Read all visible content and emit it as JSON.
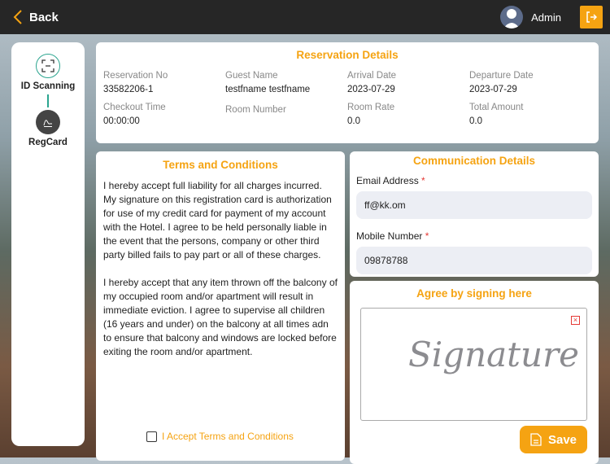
{
  "header": {
    "back_label": "Back",
    "user_name": "Admin"
  },
  "steps": [
    {
      "label": "ID Scanning"
    },
    {
      "label": "RegCard"
    }
  ],
  "reservation": {
    "title": "Reservation Details",
    "fields": [
      {
        "label": "Reservation No",
        "value": "33582206-1"
      },
      {
        "label": "Guest Name",
        "value": "testfname testfname"
      },
      {
        "label": "Arrival Date",
        "value": "2023-07-29"
      },
      {
        "label": "Departure Date",
        "value": "2023-07-29"
      },
      {
        "label": "Checkout Time",
        "value": "00:00:00"
      },
      {
        "label": "Room Number",
        "value": ""
      },
      {
        "label": "Room Rate",
        "value": "0.0"
      },
      {
        "label": "Total Amount",
        "value": "0.0"
      }
    ]
  },
  "terms": {
    "title": "Terms and Conditions",
    "p1": "I hereby accept full liability for all charges incurred. My signature on this registration card is authorization for use of my credit card for payment of my account with the Hotel. I agree to be held personally liable in the event that the persons, company or other third party billed fails to pay part or all of these charges.",
    "p2": "I hereby accept that any item thrown off the balcony of my occupied room and/or apartment will result in immediate eviction. I agree to supervise all children (16 years and under) on the balcony at all times adn to ensure that balcony and windows are locked before exiting the room and/or apartment.",
    "accept_label": "I Accept Terms and Conditions",
    "accepted": false
  },
  "communication": {
    "title": "Communication Details",
    "email_label": "Email Address",
    "email_value": "ff@kk.om",
    "mobile_label": "Mobile Number",
    "mobile_value": "09878788",
    "required_mark": "*"
  },
  "signature": {
    "title": "Agree by signing here",
    "signature_text": "Signature",
    "save_label": "Save"
  },
  "colors": {
    "accent": "#f5a312",
    "topbar": "#262626",
    "teal": "#2ba58f"
  }
}
